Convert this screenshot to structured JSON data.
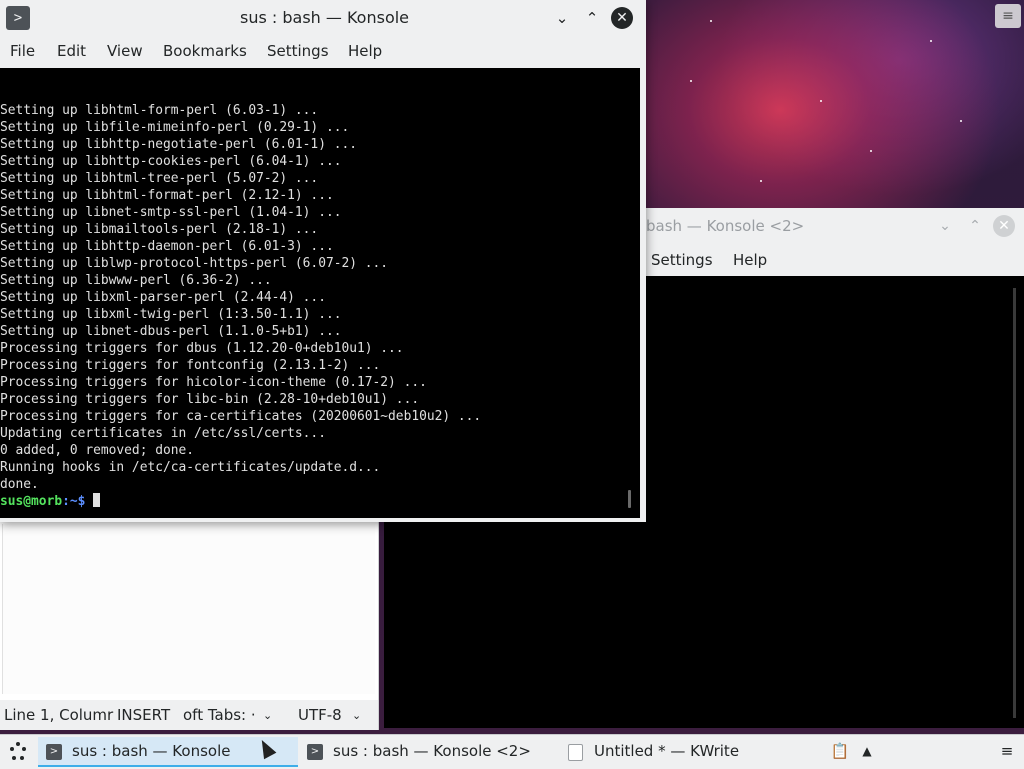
{
  "konsole_front": {
    "title": "sus : bash — Konsole",
    "menu": [
      "File",
      "Edit",
      "View",
      "Bookmarks",
      "Settings",
      "Help"
    ],
    "lines": [
      "Setting up libhtml-form-perl (6.03-1) ...",
      "Setting up libfile-mimeinfo-perl (0.29-1) ...",
      "Setting up libhttp-negotiate-perl (6.01-1) ...",
      "Setting up libhttp-cookies-perl (6.04-1) ...",
      "Setting up libhtml-tree-perl (5.07-2) ...",
      "Setting up libhtml-format-perl (2.12-1) ...",
      "Setting up libnet-smtp-ssl-perl (1.04-1) ...",
      "Setting up libmailtools-perl (2.18-1) ...",
      "Setting up libhttp-daemon-perl (6.01-3) ...",
      "Setting up liblwp-protocol-https-perl (6.07-2) ...",
      "Setting up libwww-perl (6.36-2) ...",
      "Setting up libxml-parser-perl (2.44-4) ...",
      "Setting up libxml-twig-perl (1:3.50-1.1) ...",
      "Setting up libnet-dbus-perl (1.1.0-5+b1) ...",
      "Processing triggers for dbus (1.12.20-0+deb10u1) ...",
      "Processing triggers for fontconfig (2.13.1-2) ...",
      "Processing triggers for hicolor-icon-theme (0.17-2) ...",
      "Processing triggers for libc-bin (2.28-10+deb10u1) ...",
      "Processing triggers for ca-certificates (20200601~deb10u2) ...",
      "Updating certificates in /etc/ssl/certs...",
      "0 added, 0 removed; done.",
      "Running hooks in /etc/ca-certificates/update.d...",
      "done."
    ],
    "prompt_user": "sus@morb",
    "prompt_path": ":~$",
    "colors": {
      "prompt_user": "#54e35e",
      "prompt_path": "#5c8fff"
    }
  },
  "konsole_back": {
    "title": "bash — Konsole <2>",
    "menu": [
      "Settings",
      "Help"
    ]
  },
  "kwrite": {
    "status": {
      "position": "Line 1, Columr",
      "mode": "INSERT",
      "tabs": "oft Tabs: ·",
      "encoding": "UTF-8"
    }
  },
  "taskbar": {
    "tasks": [
      {
        "label": "sus : bash — Konsole",
        "icon": "terminal-icon",
        "active": true
      },
      {
        "label": "sus : bash — Konsole <2>",
        "icon": "terminal-icon",
        "active": false
      },
      {
        "label": "Untitled * — KWrite",
        "icon": "document-icon",
        "active": false
      }
    ]
  }
}
